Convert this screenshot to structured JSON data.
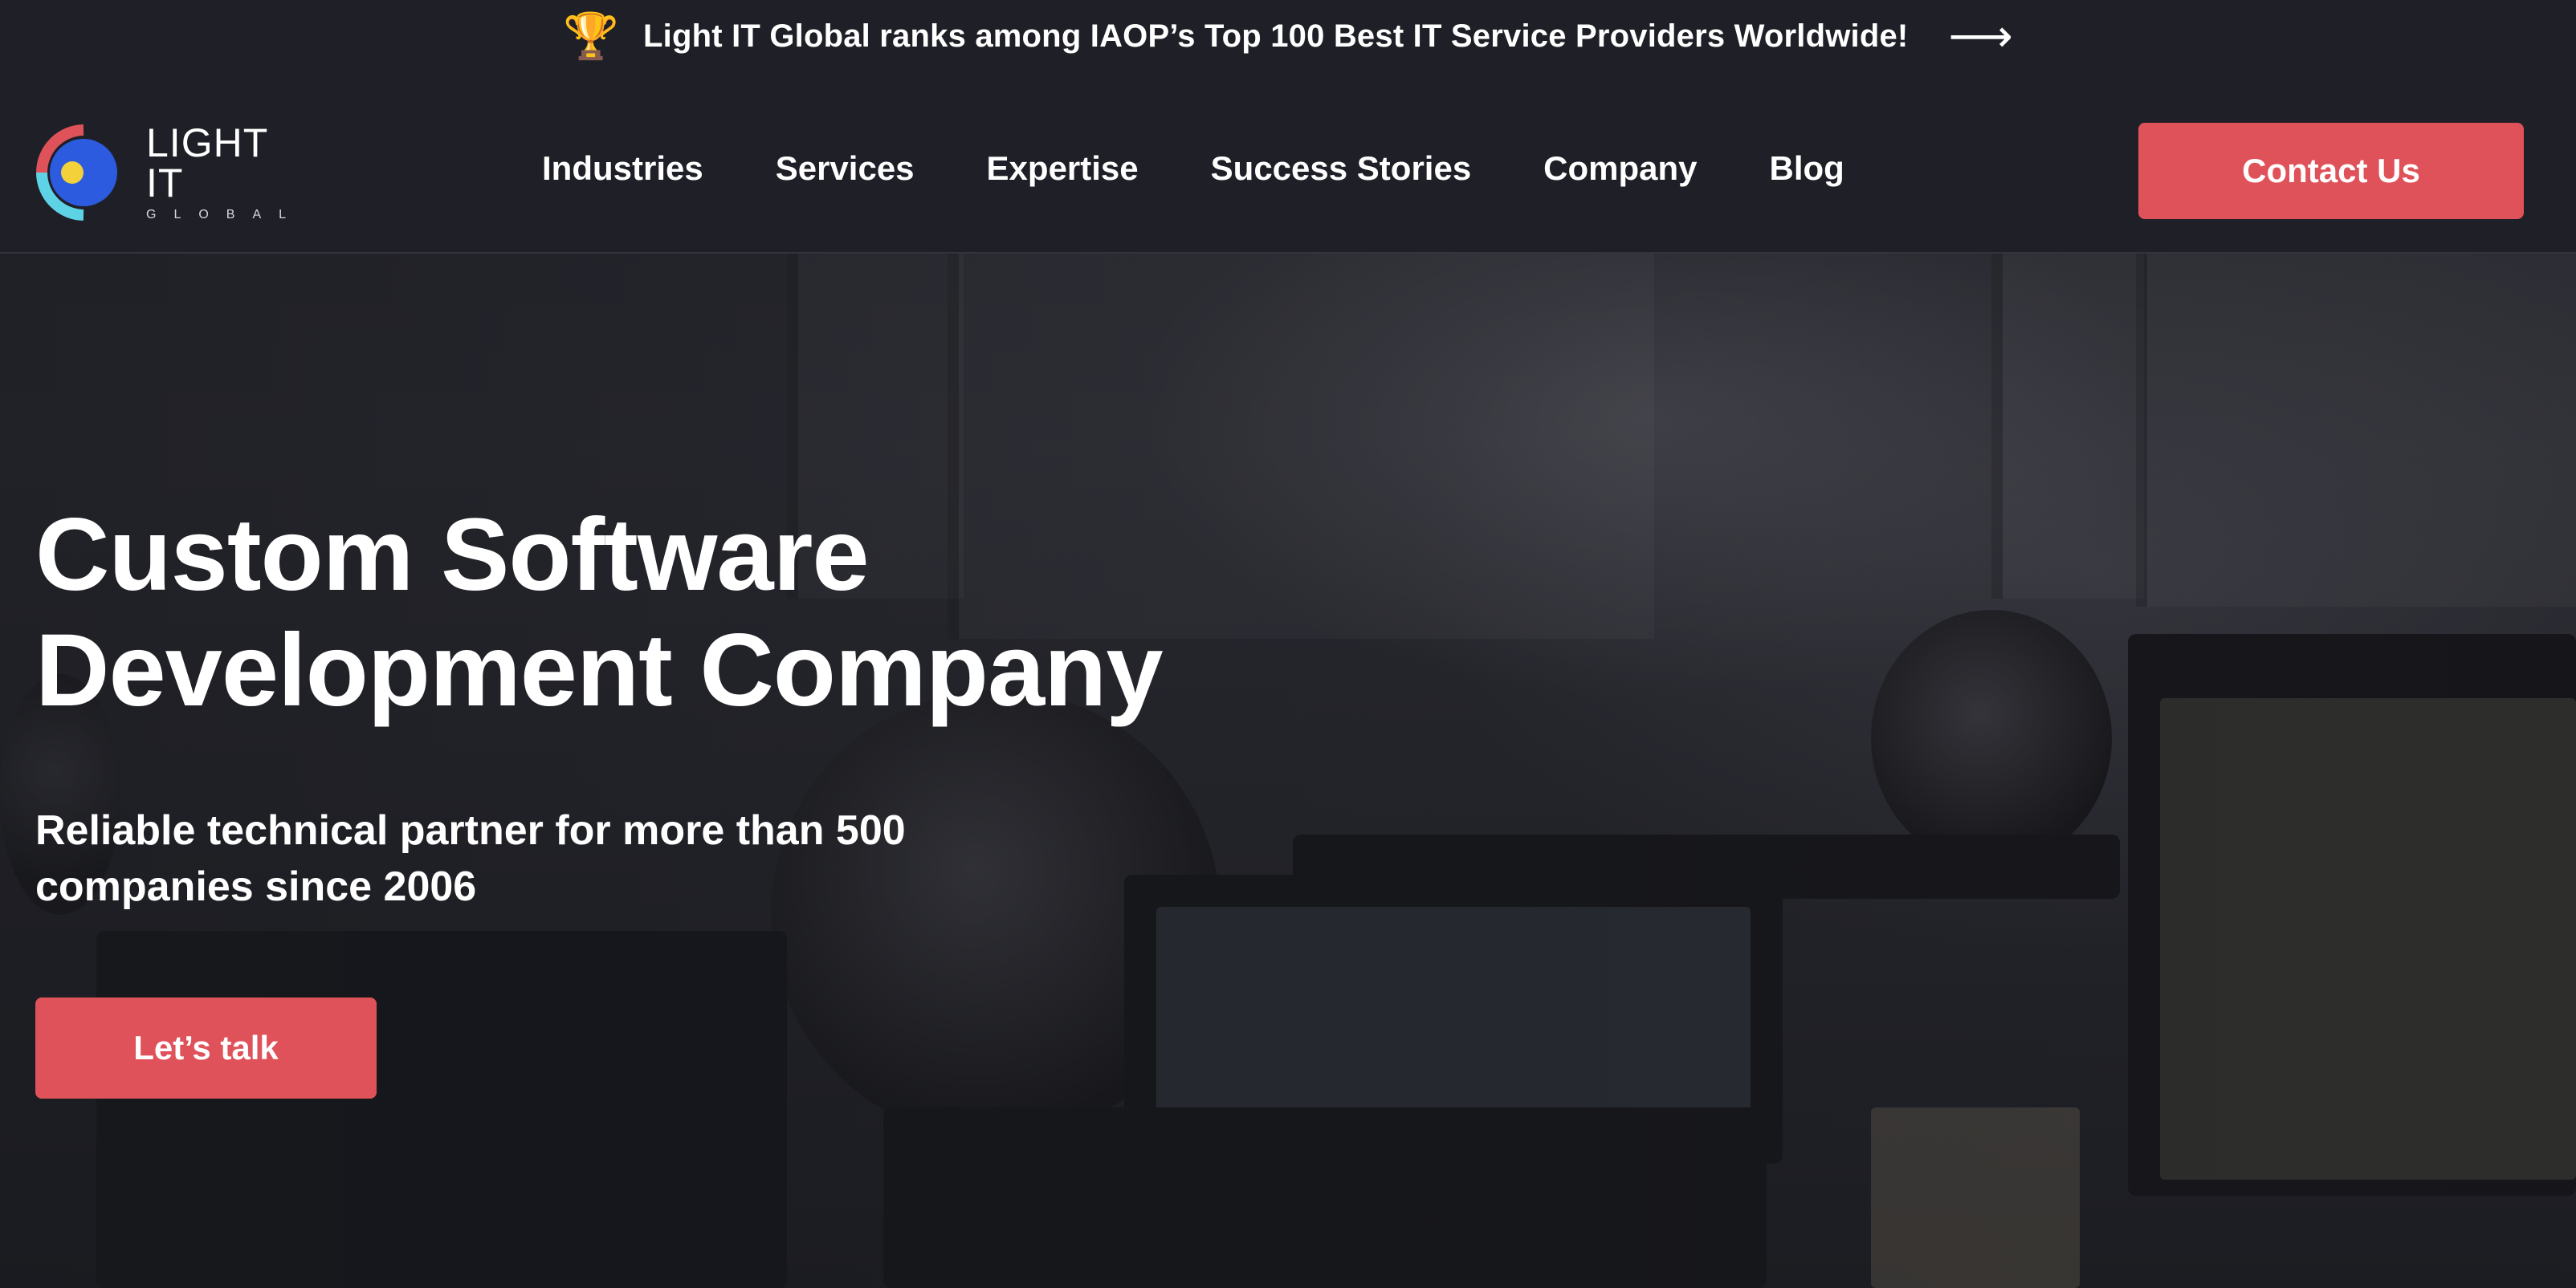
{
  "announcement": {
    "icon": "trophy-icon",
    "text": "Light IT Global ranks among IAOP’s Top 100 Best IT Service Providers Worldwide!",
    "arrow_icon": "arrow-right-icon"
  },
  "header": {
    "logo": {
      "main": "LIGHT IT",
      "sub": "GLOBAL"
    },
    "nav": [
      {
        "label": "Industries"
      },
      {
        "label": "Services"
      },
      {
        "label": "Expertise"
      },
      {
        "label": "Success Stories"
      },
      {
        "label": "Company"
      },
      {
        "label": "Blog"
      }
    ],
    "contact_label": "Contact Us"
  },
  "hero": {
    "title_line1": "Custom Software",
    "title_line2": "Development Company",
    "subtitle_line1": "Reliable technical partner for more than 500",
    "subtitle_line2": "companies since 2006",
    "cta_label": "Let’s talk"
  },
  "colors": {
    "background": "#1f2027",
    "accent": "#e0525a",
    "logo_red": "#e0525a",
    "logo_cyan": "#5fd3e6",
    "logo_blue": "#2c5be0",
    "logo_yellow": "#f2d13b"
  }
}
